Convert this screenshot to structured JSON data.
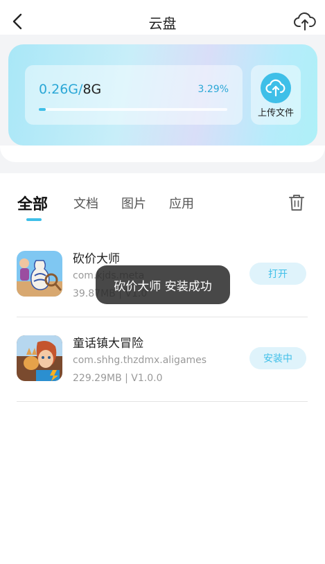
{
  "header": {
    "title": "云盘",
    "back_icon": "chevron-left-icon",
    "right_icon": "cloud-upload-icon"
  },
  "storage": {
    "used": "0.26G",
    "separator": "/",
    "total": "8G",
    "percent_label": "3.29%",
    "percent_value": 3.29,
    "upload_label": "上传文件",
    "upload_icon": "upload-cloud-icon",
    "accent_color": "#3fbfe8"
  },
  "tabs": [
    {
      "label": "全部",
      "active": true
    },
    {
      "label": "文档",
      "active": false
    },
    {
      "label": "图片",
      "active": false
    },
    {
      "label": "应用",
      "active": false
    }
  ],
  "trash_icon": "trash-icon",
  "apps": [
    {
      "name": "砍价大师",
      "package": "com.kjds.meta",
      "meta": "39.87MB | V1.0",
      "button": "打开",
      "icon": "vase-game-icon"
    },
    {
      "name": "童话镇大冒险",
      "package": "com.shhg.thzdmx.aligames",
      "meta": "229.29MB | V1.0.0",
      "button": "安装中",
      "icon": "fairytale-game-icon"
    }
  ],
  "toast": {
    "text": "砍价大师 安装成功"
  }
}
